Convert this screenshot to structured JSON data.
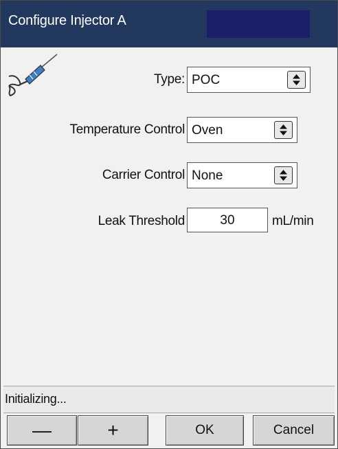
{
  "window": {
    "title": "Configure Injector A",
    "accent_color": "#22385e",
    "title_block_color": "#1b1f6b"
  },
  "icon": "syringe-icon",
  "form": {
    "type": {
      "label": "Type:",
      "value": "POC"
    },
    "temperature_control": {
      "label": "Temperature Control",
      "value": "Oven"
    },
    "carrier_control": {
      "label": "Carrier Control",
      "value": "None"
    },
    "leak_threshold": {
      "label": "Leak Threshold",
      "value": "30",
      "unit": "mL/min"
    }
  },
  "status": {
    "text": "Initializing..."
  },
  "buttons": {
    "minus": "—",
    "plus": "+",
    "ok": "OK",
    "cancel": "Cancel"
  }
}
